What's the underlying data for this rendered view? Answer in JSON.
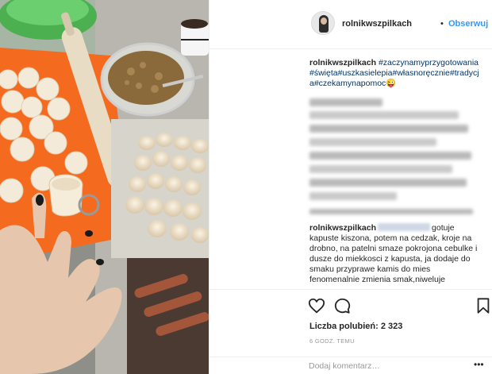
{
  "post": {
    "username": "rolnikwszpilkach",
    "separator": "•",
    "follow_label": "Obserwuj",
    "caption": {
      "username": "rolnikwszpilkach",
      "hashtags": "#zaczynamyprzygotowania#święta#uszkasielepia#własnoręcznie#tradycja#czekamynapomoc😜"
    },
    "comment": {
      "username": "rolnikwszpilkach",
      "text": "gotuje kapuste kiszona, potem na cedzak, kroje na drobno, na patelni smaze pokrojona cebulke i dusze do miekkosci z kapusta, ja dodaje do smaku przyprawe kamis do mies fenomenalnie zmienia smak,niweluje"
    },
    "likes_label": "Liczba polubień: 2 323",
    "time_label": "6 GODZ. TEMU",
    "add_comment_placeholder": "Dodaj komentarz…",
    "more_label": "•••",
    "icons": {
      "heart": "heart-outline-icon",
      "comment": "comment-bubble-icon",
      "save": "bookmark-icon"
    },
    "colors": {
      "follow": "#3897f0",
      "hashtag": "#003569",
      "muted": "#999999"
    }
  }
}
